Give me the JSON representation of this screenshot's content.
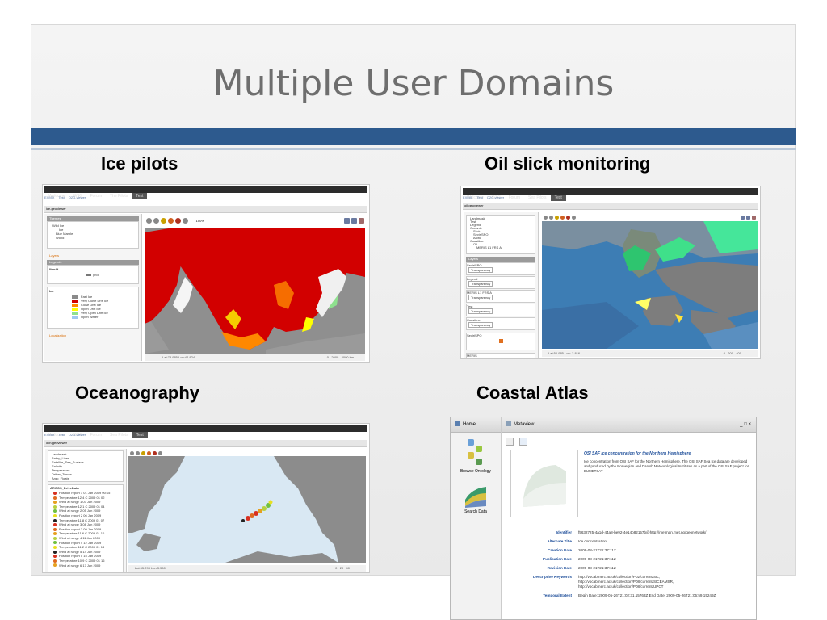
{
  "slide": {
    "title": "Multiple User Domains",
    "accent_color": "#2d5a8e"
  },
  "sections": {
    "ice": "Ice pilots",
    "oil": "Oil slick monitoring",
    "ocean": "Oceanography",
    "coastal": "Coastal Atlas"
  },
  "ice_app": {
    "nav": [
      "Welcome",
      "WIKI",
      "Forum",
      "The Pilots",
      "Test"
    ],
    "crumbs": [
      "EXMIX",
      "Test",
      "O2G-viewer"
    ],
    "header": "ice-geoviewer",
    "themes_title": "Themes",
    "tree": [
      "Wild Ice",
      "Ice",
      "Blue Marble",
      "World"
    ],
    "layers_title": "Layers",
    "legend_title": "Legends",
    "world_label": "World",
    "grid_label": "grid",
    "ice_label": "Ice",
    "legend": [
      {
        "label": "Fast Ice",
        "color": "#8a8a8a"
      },
      {
        "label": "Very Close Drift Ice",
        "color": "#d20000"
      },
      {
        "label": "Close Drift Ice",
        "color": "#ff8800"
      },
      {
        "label": "Open Drift Ice",
        "color": "#ffff00"
      },
      {
        "label": "Very Open Drift Ice",
        "color": "#8ee08e"
      },
      {
        "label": "Open Water",
        "color": "#9ec7f0"
      }
    ],
    "localization": "Localization",
    "zoom": "100%",
    "status": "Lat:73.985 Lon:42.824",
    "scale": [
      "0",
      "2000",
      "4000"
    ],
    "scale_unit": "km"
  },
  "oil_app": {
    "nav": [
      "Welcome",
      "WIKI",
      "Forum",
      "Sea Pilots",
      "Test"
    ],
    "crumbs": [
      "EXMIX",
      "Test",
      "O2G-viewer"
    ],
    "header": "oil-geoviewer",
    "tree": [
      "Landmask",
      "Test",
      "Legend",
      "Oceanic",
      "Slick",
      "SeviriSPO",
      "Arctic",
      "Coastline",
      "Oil",
      "MERIS L1 FRS A"
    ],
    "layers_title": "Layers",
    "layer_items": [
      "SeviriSPO",
      "Legend",
      "MERIS L1 FRS A",
      "Test",
      "Coastline"
    ],
    "control_label": "Transparency",
    "legends": [
      "SeviriSPO",
      "MERIS"
    ],
    "status": "Lat:56.985 Lon:-2.816",
    "scale": [
      "0",
      "200",
      "400"
    ]
  },
  "ocean_app": {
    "nav": [
      "Welcome",
      "WIKI",
      "Forum",
      "Sea Pilots",
      "Test"
    ],
    "crumbs": [
      "EXMIX",
      "Test",
      "O2G-viewer"
    ],
    "header": "ocn-geoviewer",
    "tree": [
      "Landmask",
      "Bathy_Lines",
      "Satellite_Sea_Surface",
      "Salinity",
      "Temperature",
      "Drifter_Tracks",
      "Argo_Floats"
    ],
    "list_title": "ARGOS_DriveData",
    "list": [
      "Position report 1 01 Jan 2009 00:15",
      "Temperature 12.4 C 2009 01 02",
      "Wind at range 1 03 Jan 2009",
      "Temperature 12.1 C 2009 01 04",
      "Wind at range 2 05 Jan 2009",
      "Position report 2 06 Jan 2009",
      "Temperature 11.8 C 2009 01 07",
      "Wind at range 3 08 Jan 2009",
      "Position report 3 09 Jan 2009",
      "Temperature 11.6 C 2009 01 10",
      "Wind at range 4 11 Jan 2009",
      "Position report 4 12 Jan 2009",
      "Temperature 11.2 C 2009 01 13",
      "Wind at range 5 14 Jan 2009",
      "Position report 5 15 Jan 2009",
      "Temperature 10.9 C 2009 01 16",
      "Wind at range 6 17 Jan 2009"
    ],
    "status": "Lat:55.293 Lon:3.560",
    "scale": [
      "0",
      "20",
      "40"
    ]
  },
  "coastal_app": {
    "home": "Home",
    "browse": "Browse Ontology",
    "search": "Search Data",
    "window_title": "Metaview",
    "controls": [
      "_",
      "□",
      "×"
    ],
    "meta_title": "OSI SAF Ice concentration for the Northern Hemisphere",
    "meta_abstract": "Ice concentration from OSI SAF for the Northern Hemisphere. The OSI SAF Sea Ice data are developed and produced by the Norwegian and Danish Meteorological Institutes as a part of the OSI SAF project for EUMETSAT",
    "fields": [
      {
        "key": "Identifier",
        "value": "f5632725-4a1d-44a8-be92-4e14b82157b@http://metman.met.no/geonetwork/"
      },
      {
        "key": "Alternate Title",
        "value": "Ice concentration"
      },
      {
        "key": "Creation Date",
        "value": "2009-08-21T21:37:11Z"
      },
      {
        "key": "Publication Date",
        "value": "2009-08-21T21:37:11Z"
      },
      {
        "key": "Revision Date",
        "value": "2009-08-21T21:37:11Z"
      },
      {
        "key": "Descriptive Keywords",
        "value": "http://vocab.nerc.ac.uk/collection/P02/current/SIL, http://vocab.nerc.ac.uk/collection/P08/current/SICEAMSR, http://vocab.nerc.ac.uk/collection/P08/current/UPCT"
      },
      {
        "key": "Temporal Extent",
        "value": "Begin Date: 2009-05-26T21:02:31.15763Z  End Date: 2009-05-26T21:05:59.15249Z"
      }
    ]
  }
}
